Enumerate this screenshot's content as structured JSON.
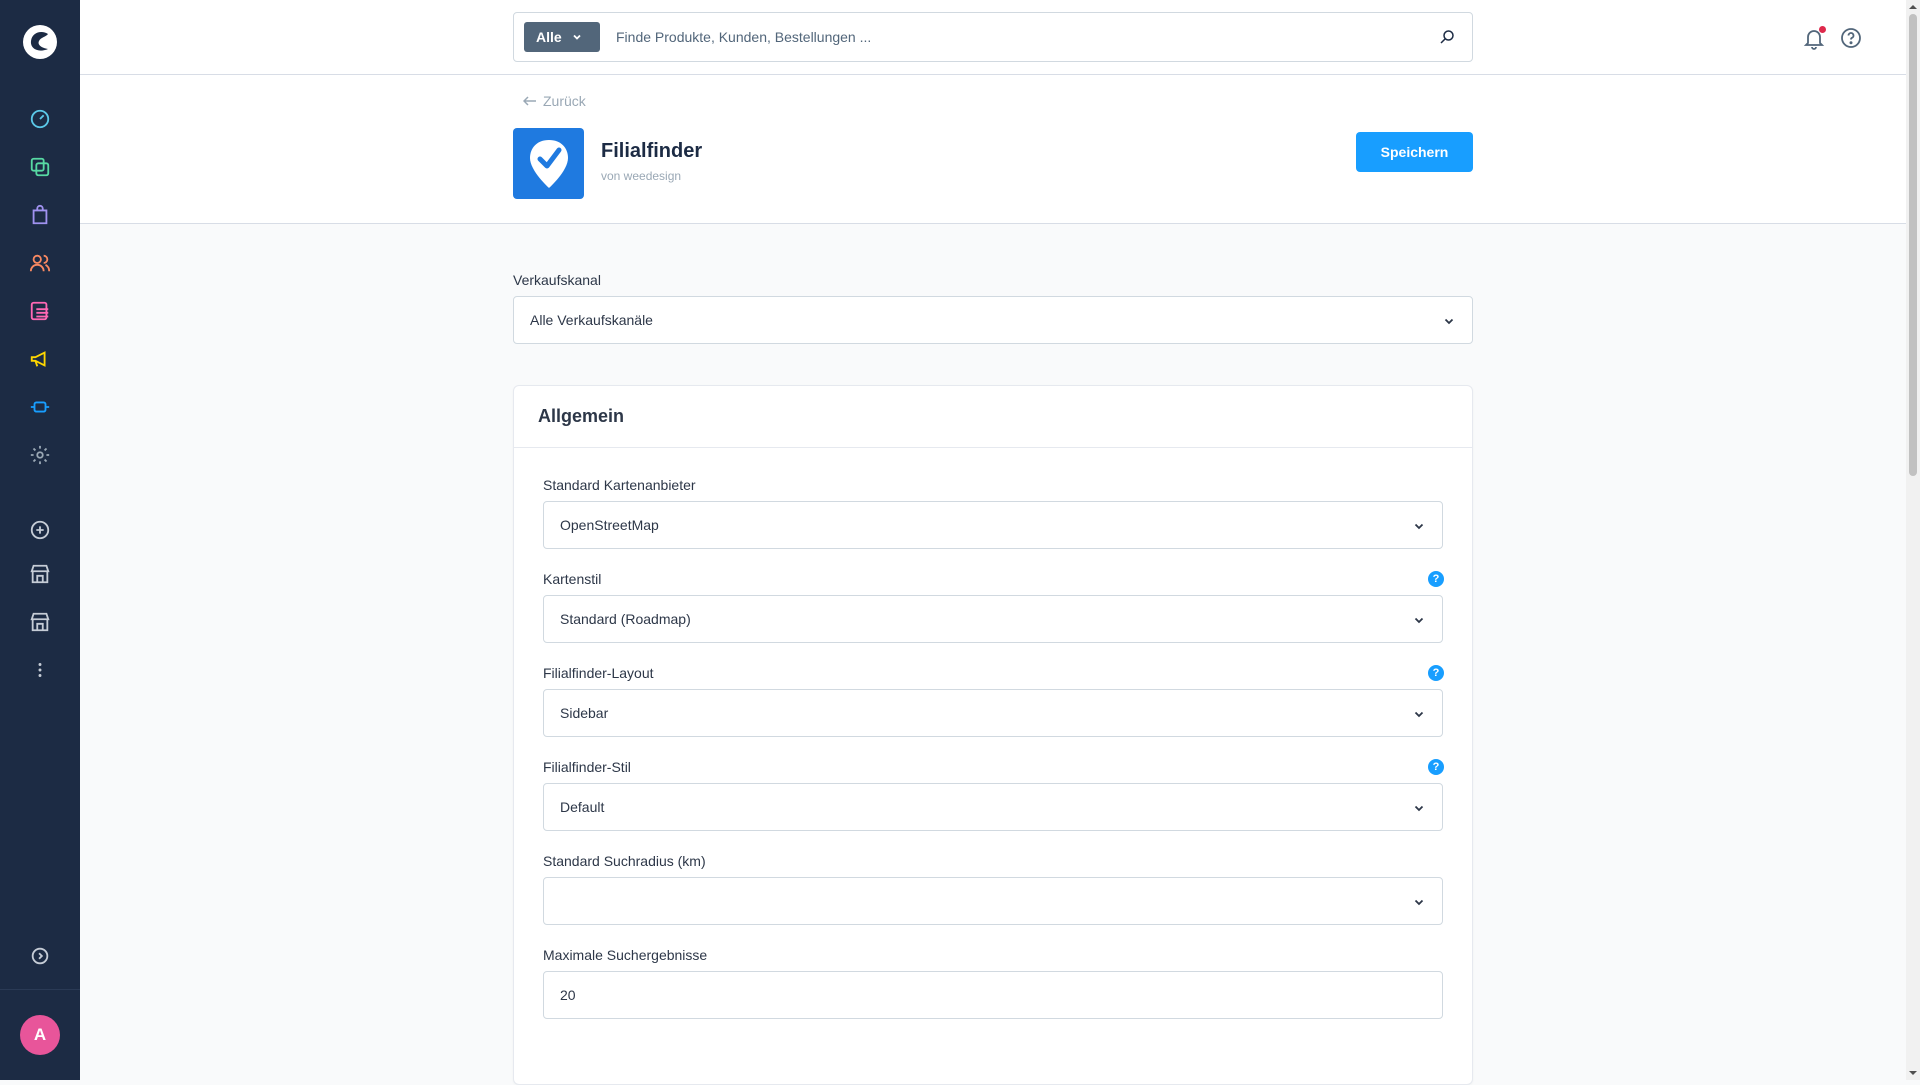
{
  "search": {
    "scope_label": "Alle",
    "placeholder": "Finde Produkte, Kunden, Bestellungen ..."
  },
  "header": {
    "back_label": "Zurück",
    "app_title": "Filialfinder",
    "app_vendor": "von weedesign",
    "save_label": "Speichern"
  },
  "sales_channel": {
    "label": "Verkaufskanal",
    "value": "Alle Verkaufskanäle"
  },
  "card": {
    "title": "Allgemein",
    "fields": [
      {
        "label": "Standard Kartenanbieter",
        "value": "OpenStreetMap",
        "help": false
      },
      {
        "label": "Kartenstil",
        "value": "Standard (Roadmap)",
        "help": true
      },
      {
        "label": "Filialfinder-Layout",
        "value": "Sidebar",
        "help": true
      },
      {
        "label": "Filialfinder-Stil",
        "value": "Default",
        "help": true
      },
      {
        "label": "Standard Suchradius (km)",
        "value": "",
        "help": false
      }
    ],
    "max_results": {
      "label": "Maximale Suchergebnisse",
      "value": "20"
    }
  },
  "user": {
    "avatar_initial": "A"
  },
  "colors": {
    "sidebar_bg": "#1c2b44",
    "primary": "#189eff",
    "avatar": "#e8559a"
  },
  "icons": {
    "sidebar": [
      "dashboard-icon",
      "catalog-icon",
      "orders-icon",
      "customers-icon",
      "content-icon",
      "marketing-icon",
      "extensions-icon",
      "settings-icon",
      "add-sales-channel-icon",
      "storefront-icon",
      "storefront-icon",
      "more-icon",
      "collapse-icon"
    ]
  }
}
